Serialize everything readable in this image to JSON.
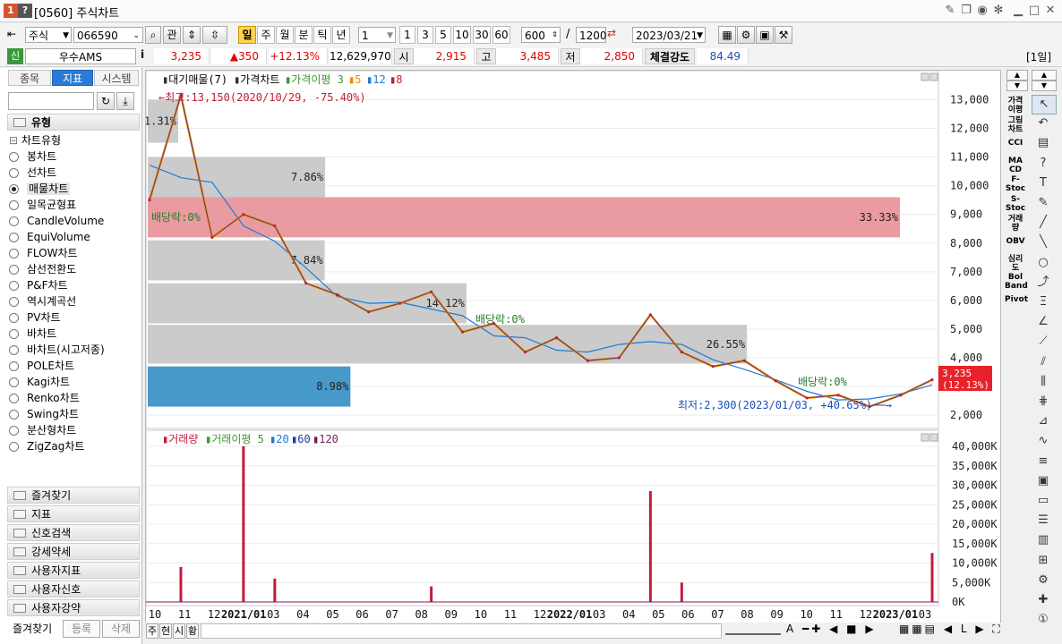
{
  "window": {
    "badge1": "1",
    "badge2": "?",
    "title": "[0560] 주식차트"
  },
  "toolbar": {
    "market": "주식",
    "code": "066590",
    "btn_gwan": "관",
    "periods": [
      {
        "label": "일",
        "selected": true
      },
      {
        "label": "주"
      },
      {
        "label": "월"
      },
      {
        "label": "분"
      },
      {
        "label": "틱"
      },
      {
        "label": "년"
      }
    ],
    "interval_select": "1",
    "intervals": [
      "1",
      "3",
      "5",
      "10",
      "30",
      "60"
    ],
    "view_count": "600",
    "slash": "/",
    "total_count": "1200",
    "date": "2023/03/21",
    "period_indicator": "[1일]"
  },
  "quote": {
    "tag": "신",
    "name": "우수AMS",
    "info": "i",
    "price": "3,235",
    "change": "▲350",
    "change_pct": "+12.13%",
    "volume": "12,629,970",
    "open_label": "시",
    "open": "2,915",
    "high_label": "고",
    "high": "3,485",
    "low_label": "저",
    "low": "2,850",
    "strength_label": "체결강도",
    "strength": "84.49"
  },
  "left": {
    "tabs": [
      {
        "label": "종목"
      },
      {
        "label": "지표",
        "selected": true
      },
      {
        "label": "시스템"
      }
    ],
    "section": "유형",
    "tree_root": "차트유형",
    "items": [
      {
        "label": "봉차트"
      },
      {
        "label": "선차트"
      },
      {
        "label": "매물차트",
        "selected": true
      },
      {
        "label": "일목균형표"
      },
      {
        "label": "CandleVolume"
      },
      {
        "label": "EquiVolume"
      },
      {
        "label": "FLOW차트"
      },
      {
        "label": "삼선전환도"
      },
      {
        "label": "P&F차트"
      },
      {
        "label": "역시계곡선"
      },
      {
        "label": "PV차트"
      },
      {
        "label": "바차트"
      },
      {
        "label": "바차트(시고저종)"
      },
      {
        "label": "POLE차트"
      },
      {
        "label": "Kagi차트"
      },
      {
        "label": "Renko차트"
      },
      {
        "label": "Swing차트"
      },
      {
        "label": "분산형차트"
      },
      {
        "label": "ZigZag차트"
      }
    ],
    "groups": [
      "즐겨찾기",
      "지표",
      "신호검색",
      "강세약세",
      "사용자지표",
      "사용자신호",
      "사용자강약"
    ],
    "bottom": {
      "fav": "즐겨찾기",
      "register": "등록",
      "delete": "삭제"
    }
  },
  "chart": {
    "legend": {
      "part1": "대기매물(7)",
      "part2": "가격차트",
      "part3": "가격이평 3",
      "ma5": "5",
      "ma12": "12",
      "ma8": "8"
    },
    "max_label": "←최고:13,150(2020/10/29, -75.40%)",
    "min_label": "최저:2,300(2023/01/03, +40.65%)──→",
    "div_labels": [
      "배당락:0%",
      "배당락:0%",
      "배당락:0%"
    ],
    "current_price": "3,235",
    "current_pct": "(12.13%)",
    "price_ticks": [
      "13,000",
      "12,000",
      "11,000",
      "10,000",
      "9,000",
      "8,000",
      "7,000",
      "6,000",
      "5,000",
      "4,000",
      "3,000",
      "2,000"
    ],
    "profile_pcts": [
      "1.31%",
      "7.86%",
      "33.33%",
      "7.84%",
      "14.12%",
      "26.55%",
      "8.98%"
    ],
    "vol_legend": {
      "v": "거래량",
      "ma": "거래이평 5",
      "m20": "20",
      "m60": "60",
      "m120": "120"
    },
    "vol_ticks": [
      "40,000K",
      "35,000K",
      "30,000K",
      "25,000K",
      "20,000K",
      "15,000K",
      "10,000K",
      "5,000K",
      "0K"
    ],
    "x_labels": [
      "10",
      "11",
      "12",
      "2021/01",
      "03",
      "04",
      "05",
      "06",
      "07",
      "08",
      "09",
      "10",
      "11",
      "12",
      "2022/01",
      "03",
      "04",
      "05",
      "06",
      "07",
      "08",
      "09",
      "10",
      "11",
      "12",
      "2023/01",
      "03"
    ]
  },
  "bottombar": {
    "b1": "주",
    "b2": "현",
    "b3": "시",
    "b4": "황"
  },
  "right": {
    "labels": [
      "가격\n이평",
      "그림\n차트",
      "CCI",
      "MA\nCD",
      "F-\nStoc",
      "S-\nStoc",
      "거래\n량",
      "OBV",
      "심리\n도",
      "Bol\nBand",
      "Pivot"
    ]
  },
  "chart_data": {
    "type": "line",
    "title": "",
    "price_range": [
      1600,
      13700
    ],
    "volume_profile": [
      {
        "pct": 1.31,
        "range": [
          11500,
          13000
        ]
      },
      {
        "pct": 7.86,
        "range": [
          9600,
          11000
        ]
      },
      {
        "pct": 33.33,
        "range": [
          8200,
          9600
        ],
        "dominant": true
      },
      {
        "pct": 7.84,
        "range": [
          6700,
          8100
        ]
      },
      {
        "pct": 14.12,
        "range": [
          5200,
          6600
        ]
      },
      {
        "pct": 26.55,
        "range": [
          3800,
          5150
        ]
      },
      {
        "pct": 8.98,
        "range": [
          2300,
          3700
        ],
        "current": true
      }
    ],
    "price_series": [
      {
        "date": "2020/09",
        "price": 9500
      },
      {
        "date": "2020/10/29",
        "price": 13150
      },
      {
        "date": "2020/11",
        "price": 8200
      },
      {
        "date": "2020/12",
        "price": 9000
      },
      {
        "date": "2021/01",
        "price": 8600
      },
      {
        "date": "2021/02",
        "price": 6600
      },
      {
        "date": "2021/03",
        "price": 6200
      },
      {
        "date": "2021/05",
        "price": 5600
      },
      {
        "date": "2021/07",
        "price": 5900
      },
      {
        "date": "2021/09",
        "price": 6300
      },
      {
        "date": "2021/09b",
        "price": 4900
      },
      {
        "date": "2021/10",
        "price": 5200
      },
      {
        "date": "2021/12",
        "price": 4200
      },
      {
        "date": "2022/01",
        "price": 4700
      },
      {
        "date": "2022/02",
        "price": 3900
      },
      {
        "date": "2022/04",
        "price": 4000
      },
      {
        "date": "2022/05",
        "price": 5500
      },
      {
        "date": "2022/06",
        "price": 4200
      },
      {
        "date": "2022/07",
        "price": 3700
      },
      {
        "date": "2022/08",
        "price": 3900
      },
      {
        "date": "2022/09",
        "price": 3200
      },
      {
        "date": "2022/10",
        "price": 2600
      },
      {
        "date": "2022/12",
        "price": 2700
      },
      {
        "date": "2023/01/03",
        "price": 2300
      },
      {
        "date": "2023/02",
        "price": 2700
      },
      {
        "date": "2023/03/21",
        "price": 3235
      }
    ],
    "volume_ylim": [
      0,
      40000
    ],
    "volume_spikes_k": [
      {
        "date": "2020/10",
        "value": 9000
      },
      {
        "date": "2020/12",
        "value": 40000
      },
      {
        "date": "2021/01",
        "value": 6000
      },
      {
        "date": "2021/09",
        "value": 4000
      },
      {
        "date": "2022/05",
        "value": 28500
      },
      {
        "date": "2022/06",
        "value": 5000
      },
      {
        "date": "2023/03",
        "value": 12600
      }
    ]
  }
}
